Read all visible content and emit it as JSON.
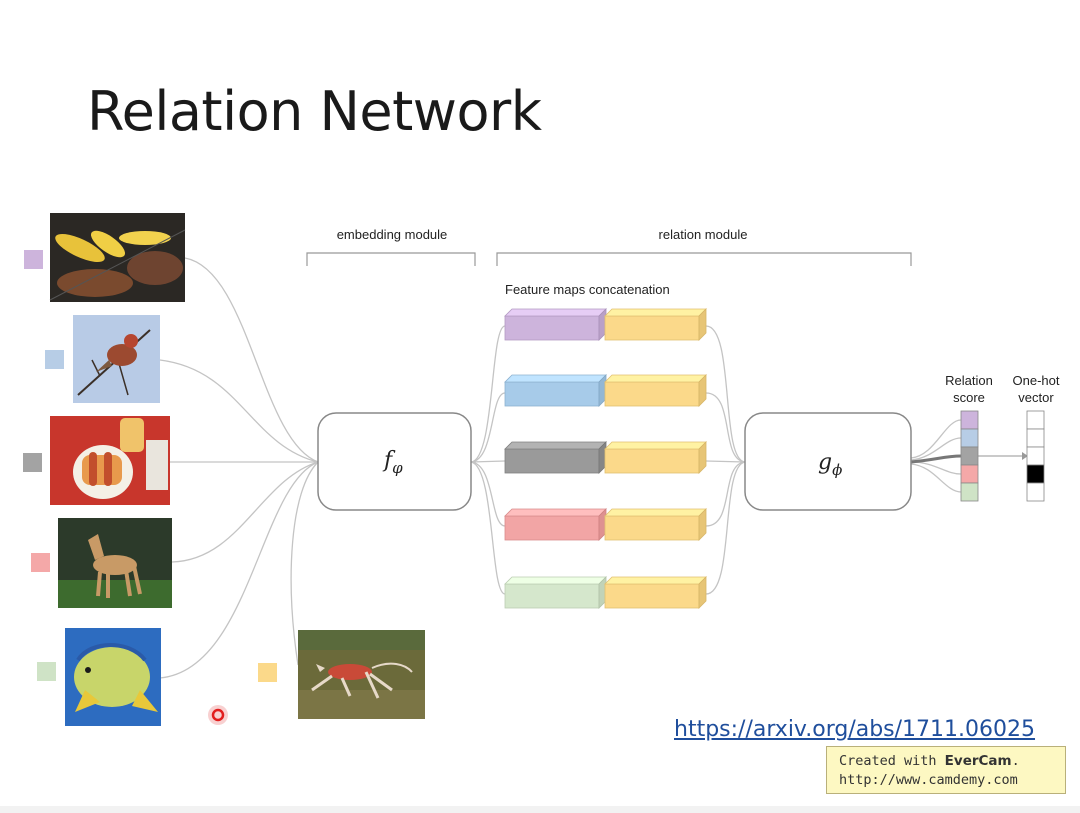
{
  "slide": {
    "title": "Relation Network",
    "link_text": "https://arxiv.org/abs/1711.06025"
  },
  "diagram": {
    "embedding_module_label": "embedding module",
    "relation_module_label": "relation module",
    "feature_maps_label": "Feature maps concatenation",
    "f_symbol": "f",
    "f_subscript": "φ",
    "g_symbol": "g",
    "g_subscript": "ϕ",
    "relation_score_line1": "Relation",
    "relation_score_line2": "score",
    "one_hot_line1": "One-hot",
    "one_hot_line2": "vector",
    "sample_images": [
      {
        "name": "food-grill",
        "color": "#cdb4dc"
      },
      {
        "name": "bird",
        "color": "#b7cde6"
      },
      {
        "name": "hotdog",
        "color": "#a3a3a3"
      },
      {
        "name": "dog",
        "color": "#f4a8a8"
      },
      {
        "name": "fish",
        "color": "#cfe3c6"
      }
    ],
    "query_image": {
      "name": "query-dog",
      "color": "#fbd98a"
    },
    "feature_pair_colors": [
      "#cdb4dc",
      "#a7cbe9",
      "#9a9a9a",
      "#f2a5a5",
      "#d5e7cc"
    ],
    "query_feature_color": "#fbd98a",
    "relation_score_colors": [
      "#cdb4dc",
      "#b7cde6",
      "#a3a3a3",
      "#f4a8a8",
      "#cfe3c6"
    ],
    "one_hot_values": [
      0,
      0,
      0,
      1,
      0
    ]
  },
  "watermark": {
    "line1_prefix": "Created with ",
    "line1_brand": "EverCam",
    "line1_suffix": ".",
    "line2": "http://www.camdemy.com"
  }
}
